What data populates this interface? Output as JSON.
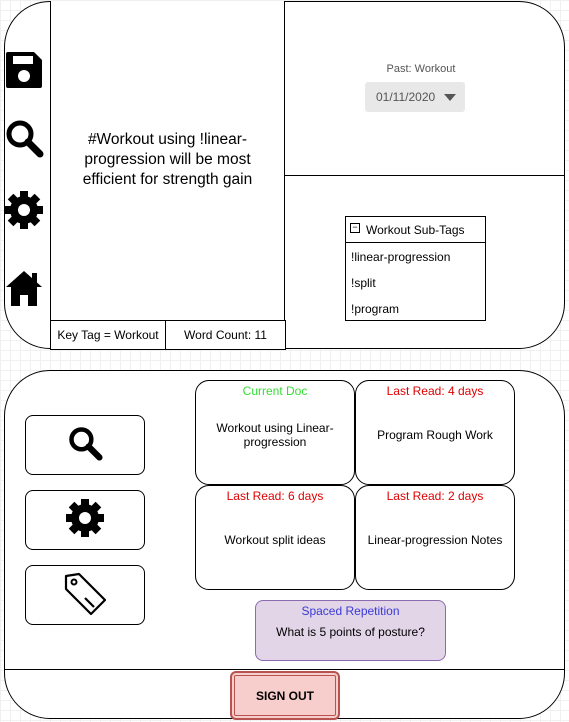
{
  "note": {
    "text": "#Workout using !linear-progression will be most efficient for strength gain",
    "key_tag": "Key Tag = Workout",
    "word_count": "Word Count: 11"
  },
  "sidebar": {
    "icons": [
      "save-icon",
      "search-icon",
      "gear-icon",
      "home-icon"
    ]
  },
  "past": {
    "label": "Past: Workout",
    "date": "01/11/2020"
  },
  "subtags": {
    "title": "Workout Sub-Tags",
    "toggle": "−",
    "items": [
      "!linear-progression",
      "!split",
      "!program"
    ]
  },
  "tools": {
    "icons": [
      "search-icon",
      "gear-icon",
      "tag-icon"
    ]
  },
  "docs": [
    {
      "status": "Current Doc",
      "status_color": "#33dd33",
      "title": "Workout using Linear-progression"
    },
    {
      "status": "Last Read: 4 days",
      "status_color": "#e00000",
      "title": "Program Rough Work"
    },
    {
      "status": "Last Read: 6 days",
      "status_color": "#e00000",
      "title": "Workout split ideas"
    },
    {
      "status": "Last Read: 2 days",
      "status_color": "#e00000",
      "title": "Linear-progression Notes"
    }
  ],
  "spaced": {
    "title": "Spaced Repetition",
    "question": "What is 5 points of posture?"
  },
  "signout_label": "SIGN OUT"
}
